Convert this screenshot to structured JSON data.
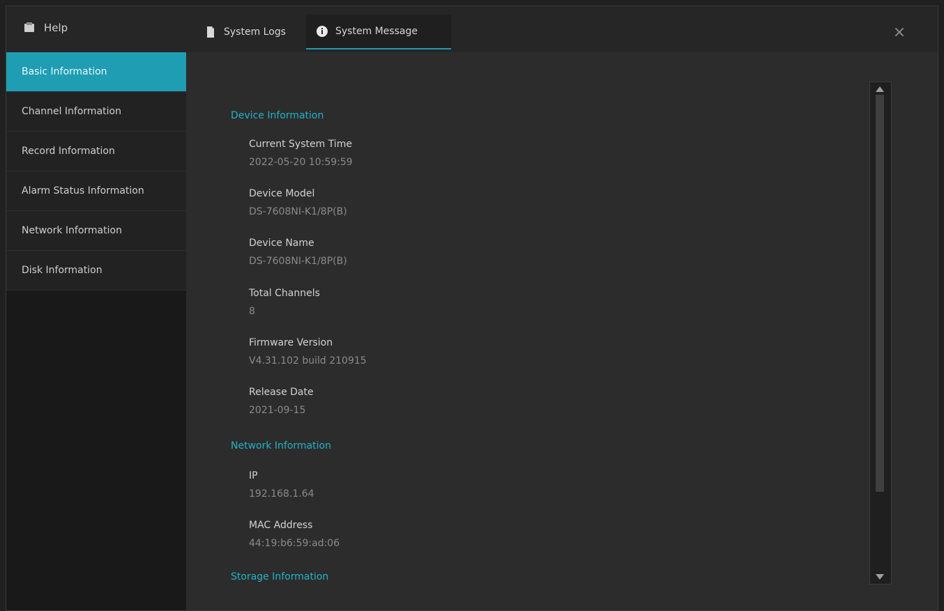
{
  "header": {
    "home_label": "Help",
    "tabs": [
      {
        "label": "System Logs"
      },
      {
        "label": "System Message"
      }
    ],
    "close_label": "×"
  },
  "sidebar": {
    "items": [
      {
        "label": "Basic Information"
      },
      {
        "label": "Channel Information"
      },
      {
        "label": "Record Information"
      },
      {
        "label": "Alarm Status Information"
      },
      {
        "label": "Network Information"
      },
      {
        "label": "Disk Information"
      }
    ]
  },
  "content": {
    "sections": [
      {
        "title": "Device Information",
        "fields": [
          {
            "label": "Current System Time",
            "value": "2022-05-20 10:59:59"
          },
          {
            "label": "Device Model",
            "value": "DS-7608NI-K1/8P(B)"
          },
          {
            "label": "Device Name",
            "value": "DS-7608NI-K1/8P(B)"
          },
          {
            "label": "Total Channels",
            "value": "8"
          },
          {
            "label": "Firmware Version",
            "value": "V4.31.102 build 210915"
          },
          {
            "label": "Release Date",
            "value": "2021-09-15"
          }
        ]
      },
      {
        "title": "Network Information",
        "fields": [
          {
            "label": "IP",
            "value": "192.168.1.64"
          },
          {
            "label": "MAC Address",
            "value": "44:19:b6:59:ad:06"
          }
        ]
      },
      {
        "title": "Storage Information",
        "fields": []
      }
    ]
  }
}
